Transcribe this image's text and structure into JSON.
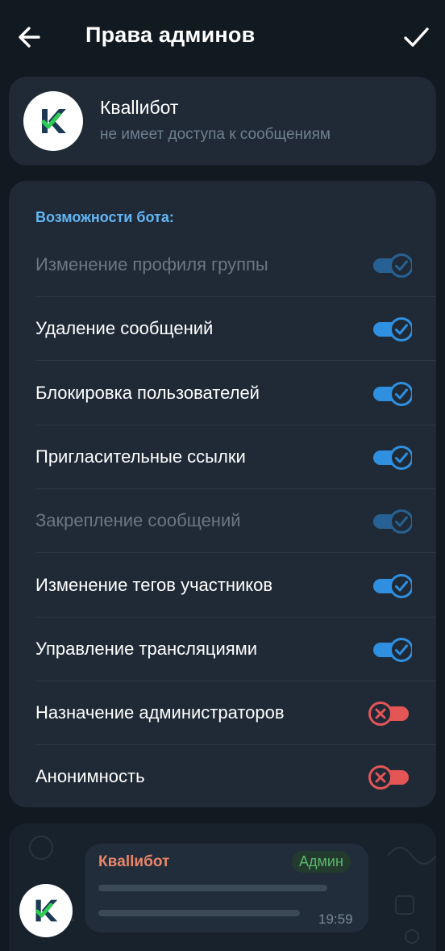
{
  "header": {
    "title": "Права админов",
    "back_icon": "arrow-left-icon",
    "confirm_icon": "checkmark-icon"
  },
  "bot": {
    "name": "Квallибот",
    "status": "не имеет доступа к сообщениям",
    "logo_icon": "kvallibot-logo-icon"
  },
  "permissions": {
    "section_title": "Возможности бота:",
    "items": [
      {
        "label": "Изменение профиля группы",
        "enabled": true,
        "disabled": true
      },
      {
        "label": "Удаление сообщений",
        "enabled": true,
        "disabled": false
      },
      {
        "label": "Блокировка пользователей",
        "enabled": true,
        "disabled": false
      },
      {
        "label": "Пригласительные ссылки",
        "enabled": true,
        "disabled": false
      },
      {
        "label": "Закрепление сообщений",
        "enabled": true,
        "disabled": true
      },
      {
        "label": "Изменение тегов участников",
        "enabled": true,
        "disabled": false
      },
      {
        "label": "Управление трансляциями",
        "enabled": true,
        "disabled": false
      },
      {
        "label": "Назначение администраторов",
        "enabled": false,
        "disabled": false
      },
      {
        "label": "Анонимность",
        "enabled": false,
        "disabled": false
      }
    ]
  },
  "preview": {
    "sender": "Квallибот",
    "badge": "Админ",
    "time": "19:59"
  },
  "colors": {
    "background": "#111921",
    "card": "#1f2a36",
    "accent": "#62b6f5",
    "toggle_on": "#2f8fe0",
    "toggle_off": "#e45556",
    "sender": "#e8866b",
    "badge": "#5cb86a"
  }
}
